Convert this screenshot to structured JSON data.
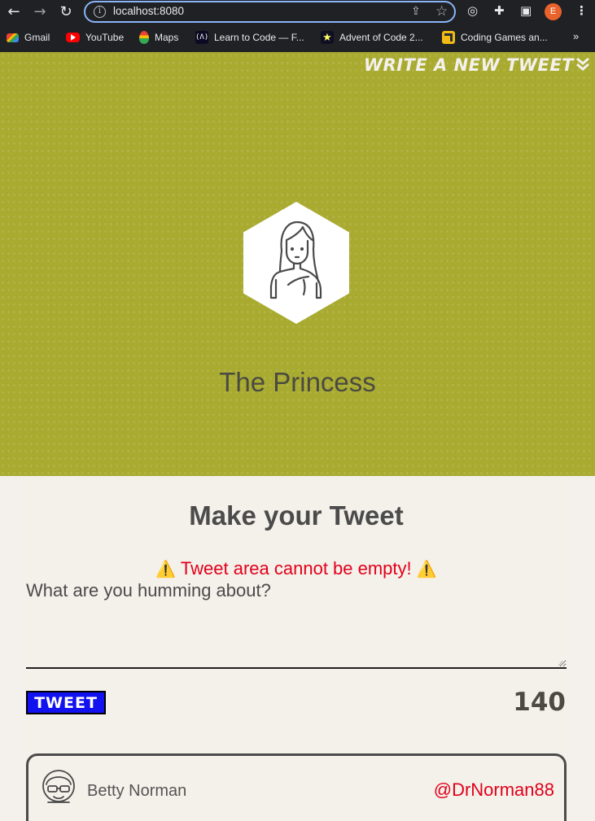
{
  "browser": {
    "url": "localhost:8080",
    "avatar_initial": "E",
    "bookmarks": [
      {
        "label": "Gmail",
        "icon": "gmail-icon"
      },
      {
        "label": "YouTube",
        "icon": "youtube-icon"
      },
      {
        "label": "Maps",
        "icon": "maps-icon"
      },
      {
        "label": "Learn to Code — F...",
        "icon": "freecodecamp-icon"
      },
      {
        "label": "Advent of Code 2...",
        "icon": "star-icon"
      },
      {
        "label": "Coding Games an...",
        "icon": "codingame-icon"
      }
    ],
    "more": "»"
  },
  "hero": {
    "write_label": "WRITE A NEW TWEET",
    "profile_name": "The Princess",
    "background_color": "#a9ab31"
  },
  "compose": {
    "title": "Make your Tweet",
    "error": "Tweet area cannot be empty!",
    "placeholder": "What are you humming about?",
    "button_label": "TWEET",
    "counter": "140"
  },
  "tweets": [
    {
      "name": "Betty Norman",
      "handle": "@DrNorman88"
    }
  ],
  "colors": {
    "error": "#e2001a",
    "button": "#1212f0",
    "handle": "#e2001a"
  }
}
